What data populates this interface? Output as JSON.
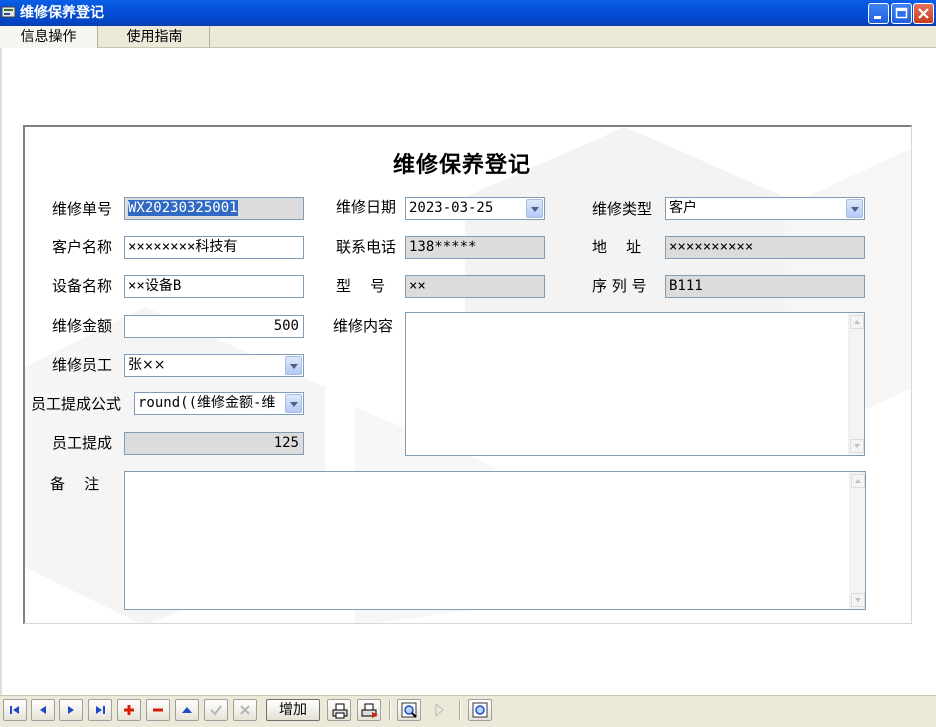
{
  "window": {
    "title": "维修保养登记"
  },
  "menu": [
    "信息操作",
    "使用指南"
  ],
  "form": {
    "title": "维修保养登记",
    "repair_no": {
      "label": "维修单号",
      "value": "WX20230325001"
    },
    "repair_date": {
      "label": "维修日期",
      "value": "2023-03-25"
    },
    "repair_type": {
      "label": "维修类型",
      "value": "客户"
    },
    "customer_name": {
      "label": "客户名称",
      "value": "××××××××科技有"
    },
    "phone": {
      "label": "联系电话",
      "value": "138*****"
    },
    "address": {
      "label": "地    址",
      "value": "××××××××××"
    },
    "device_name": {
      "label": "设备名称",
      "value": "××设备B"
    },
    "model": {
      "label": "型    号",
      "value": "××"
    },
    "serial_no": {
      "label": "序 列 号",
      "value": "B111"
    },
    "amount": {
      "label": "维修金额",
      "value": "500"
    },
    "content": {
      "label": "维修内容",
      "value": ""
    },
    "staff": {
      "label": "维修员工",
      "value": "张××"
    },
    "formula": {
      "label": "员工提成公式",
      "value": "round((维修金额-维"
    },
    "commission": {
      "label": "员工提成",
      "value": "125"
    },
    "remark": {
      "label": "备    注",
      "value": ""
    }
  },
  "toolbar": {
    "add_label": "增加",
    "icons": [
      "first-record-icon",
      "prior-record-icon",
      "next-record-icon",
      "last-record-icon",
      "insert-icon",
      "delete-icon",
      "edit-icon",
      "post-icon",
      "cancel-icon",
      "print-icon",
      "print-preview-icon",
      "search-icon",
      "play-icon",
      "zoom-icon"
    ]
  },
  "colors": {
    "titlebar": "#0550d8",
    "selection": "#316ac5",
    "readonly_field": "#dcdcdc",
    "nav_blue": "#1f49c8",
    "insert_red": "#d81e06"
  }
}
